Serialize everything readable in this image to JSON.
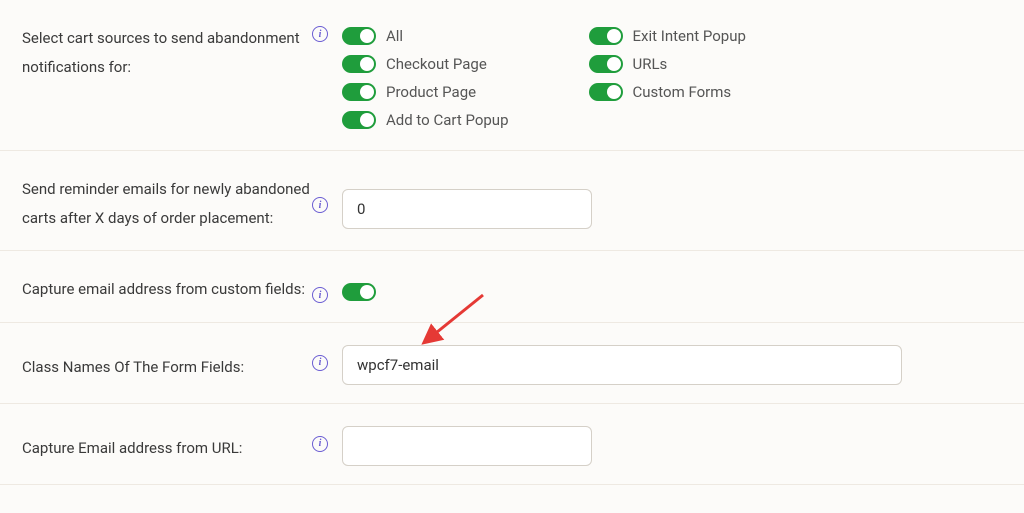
{
  "sections": {
    "cartSources": {
      "label": "Select cart sources to send abandonment notifications for:",
      "col1": [
        {
          "label": "All"
        },
        {
          "label": "Checkout Page"
        },
        {
          "label": "Product Page"
        },
        {
          "label": "Add to Cart Popup"
        }
      ],
      "col2": [
        {
          "label": "Exit Intent Popup"
        },
        {
          "label": "URLs"
        },
        {
          "label": "Custom Forms"
        }
      ]
    },
    "reminderDays": {
      "label": "Send reminder emails for newly abandoned carts after X days of order placement:",
      "value": "0"
    },
    "captureCustom": {
      "label": "Capture email address from custom fields:"
    },
    "classNames": {
      "label": "Class Names Of The Form Fields:",
      "value": "wpcf7-email"
    },
    "captureUrl": {
      "label": "Capture Email address from URL:",
      "value": ""
    }
  }
}
